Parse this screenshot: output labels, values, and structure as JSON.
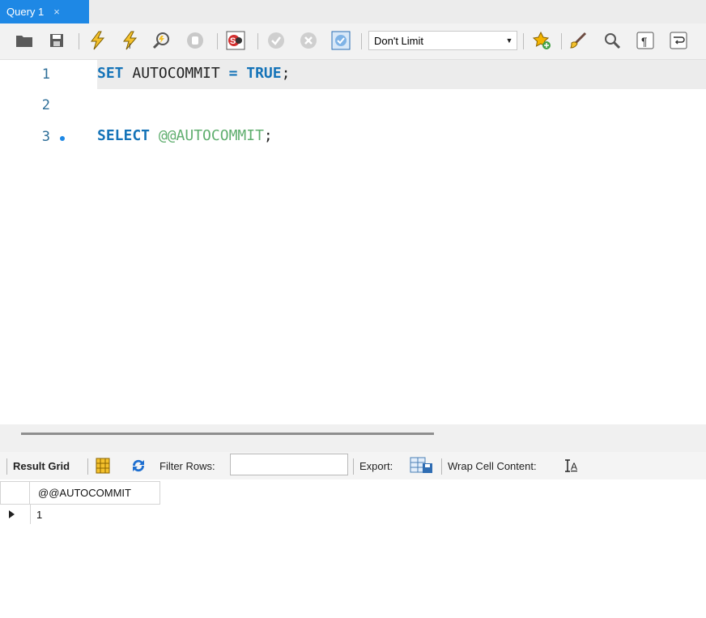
{
  "tab": {
    "label": "Query 1",
    "close": "×"
  },
  "toolbar": {
    "limit_value": "Don't Limit",
    "icons": [
      "open-folder-icon",
      "save-icon",
      "execute-icon",
      "execute-current-icon",
      "explain-icon",
      "stop-icon",
      "toggle-error-icon",
      "commit-icon",
      "rollback-icon",
      "autocommit-icon",
      "add-snippet-icon",
      "beautify-icon",
      "find-icon",
      "invisible-chars-icon",
      "wrap-lines-icon"
    ]
  },
  "editor": {
    "lines": [
      {
        "number": "1",
        "tokens": [
          "SET",
          " AUTOCOMMIT ",
          "=",
          " ",
          "TRUE",
          ";"
        ]
      },
      {
        "number": "2"
      },
      {
        "number": "3",
        "tokens": [
          "SELECT",
          " ",
          "@@AUTOCOMMIT",
          ";"
        ]
      }
    ]
  },
  "results": {
    "result_grid_label": "Result Grid",
    "filter_label": "Filter Rows:",
    "filter_value": "",
    "export_label": "Export:",
    "wrap_label": "Wrap Cell Content:",
    "columns": [
      "@@AUTOCOMMIT"
    ],
    "rows": [
      [
        "1"
      ]
    ]
  },
  "colors": {
    "accent": "#1e88e5",
    "keyword": "#1473b8",
    "sysvar": "#5fae6e"
  }
}
